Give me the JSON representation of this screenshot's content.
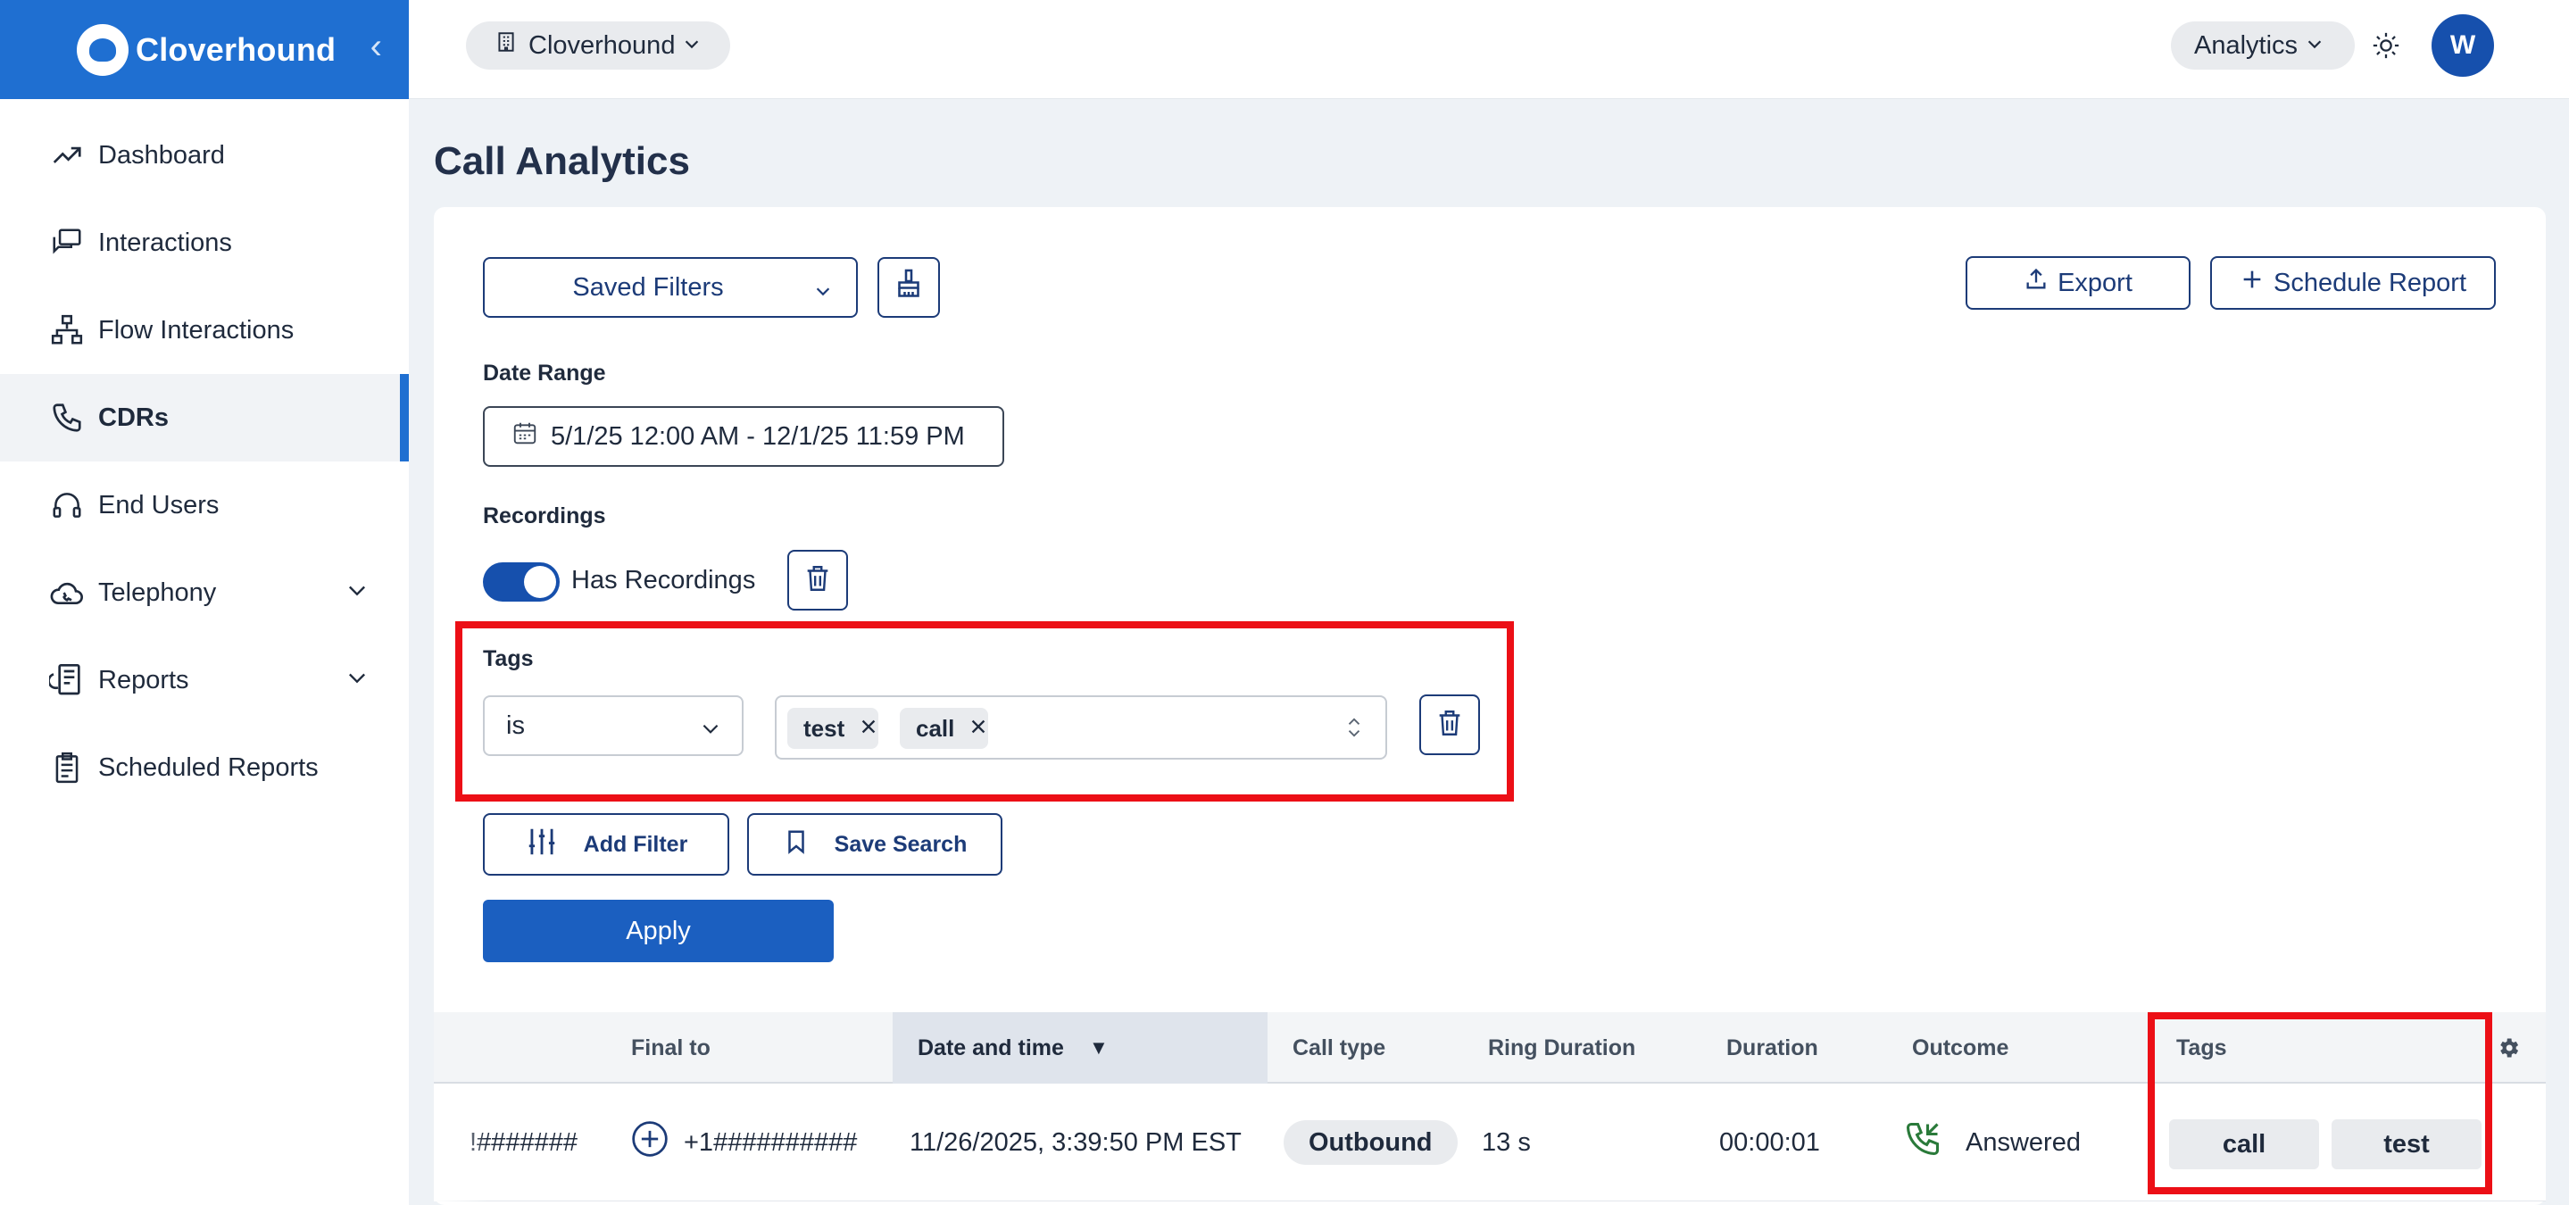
{
  "brand": {
    "name": "Cloverhound"
  },
  "sidebar": {
    "items": [
      {
        "label": "Dashboard",
        "icon": "trend-up-icon"
      },
      {
        "label": "Interactions",
        "icon": "chat-bubbles-icon"
      },
      {
        "label": "Flow Interactions",
        "icon": "sitemap-icon"
      },
      {
        "label": "CDRs",
        "icon": "phone-icon",
        "active": true
      },
      {
        "label": "End Users",
        "icon": "headset-icon"
      },
      {
        "label": "Telephony",
        "icon": "cloud-phone-icon",
        "expandable": true
      },
      {
        "label": "Reports",
        "icon": "report-phone-icon",
        "expandable": true
      },
      {
        "label": "Scheduled Reports",
        "icon": "clipboard-icon"
      }
    ]
  },
  "topbar": {
    "org": "Cloverhound",
    "section": "Analytics",
    "avatar_initial": "W"
  },
  "page": {
    "title": "Call Analytics"
  },
  "filters": {
    "saved_filters_label": "Saved Filters",
    "export_label": "Export",
    "schedule_label": "Schedule Report",
    "date_range_label": "Date Range",
    "date_range_value": "5/1/25 12:00 AM - 12/1/25 11:59 PM",
    "recordings_label": "Recordings",
    "has_recordings_label": "Has Recordings",
    "has_recordings_on": true,
    "tags_label": "Tags",
    "tags_operator": "is",
    "tags_selected": [
      "test",
      "call"
    ],
    "add_filter_label": "Add Filter",
    "save_search_label": "Save Search",
    "apply_label": "Apply"
  },
  "table": {
    "columns": {
      "final_to": "Final to",
      "date_time": "Date and time",
      "call_type": "Call type",
      "ring_duration": "Ring Duration",
      "duration": "Duration",
      "outcome": "Outcome",
      "tags": "Tags"
    },
    "sort_indicator": "▼",
    "rows": [
      {
        "from_partial": "!#######",
        "final_to": "+1##########",
        "date_time": "11/26/2025, 3:39:50 PM EST",
        "call_type": "Outbound",
        "ring_duration": "13 s",
        "duration": "00:00:01",
        "outcome": "Answered",
        "tags": [
          "call",
          "test"
        ]
      }
    ]
  },
  "colors": {
    "brand": "#1f6fd1",
    "primary": "#1b5fc0",
    "highlight": "#ec0f16",
    "answered": "#2a7a3a"
  }
}
